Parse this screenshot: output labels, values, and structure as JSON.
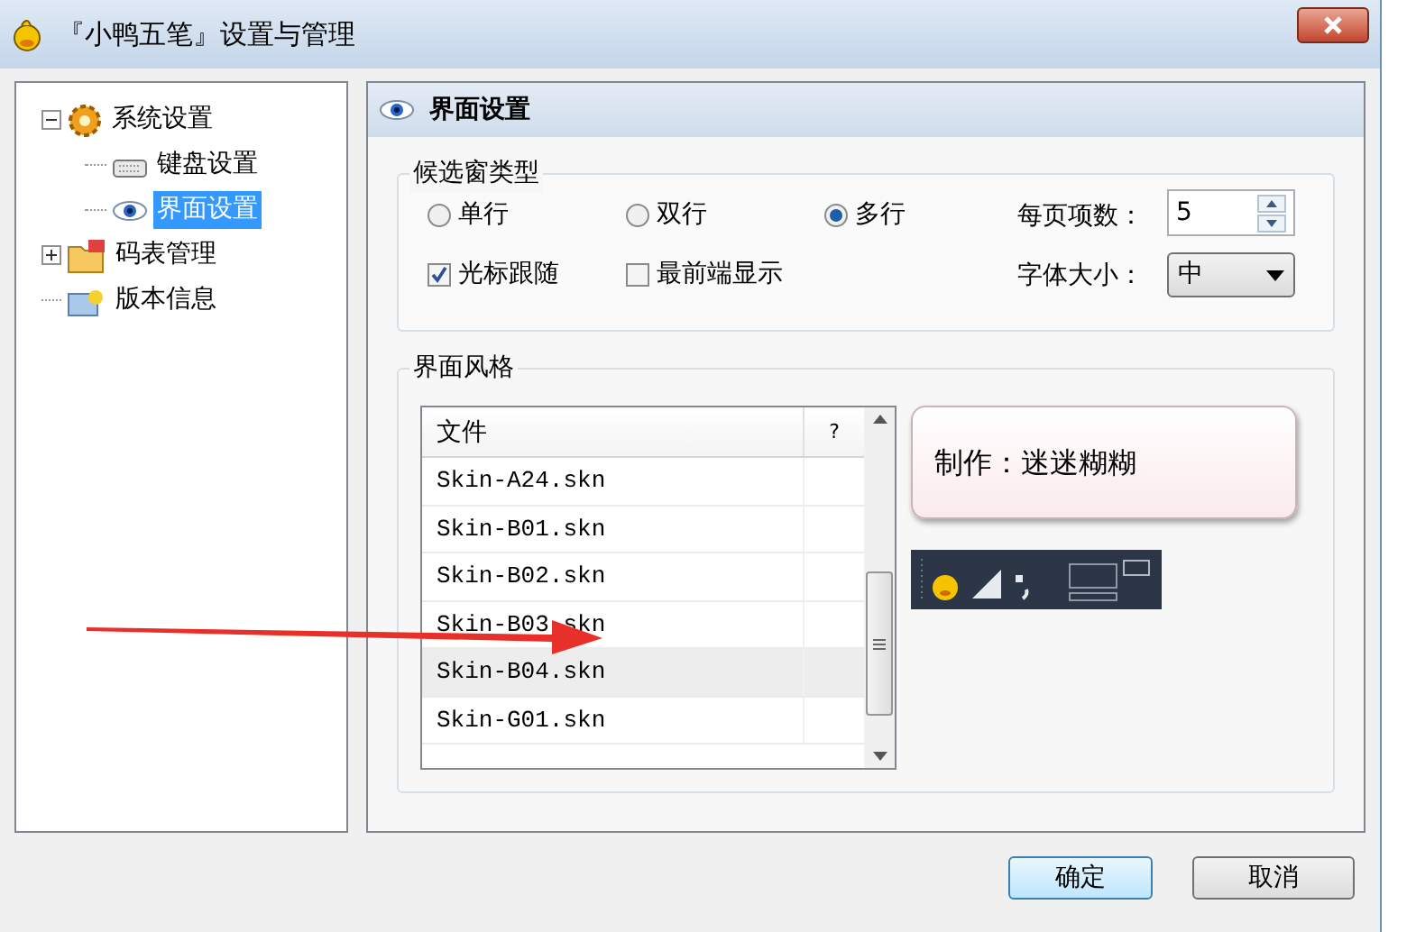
{
  "window": {
    "title": "『小鸭五笔』设置与管理"
  },
  "tree": [
    {
      "label": "系统设置",
      "expanded": true,
      "selected": false,
      "children": [
        {
          "label": "键盘设置",
          "selected": false
        },
        {
          "label": "界面设置",
          "selected": true
        }
      ]
    },
    {
      "label": "码表管理",
      "expanded": false,
      "selected": false
    },
    {
      "label": "版本信息",
      "selected": false
    }
  ],
  "panel": {
    "title": "界面设置"
  },
  "candidate_window": {
    "title": "候选窗类型",
    "layout_options": [
      {
        "label": "单行",
        "selected": false
      },
      {
        "label": "双行",
        "selected": false
      },
      {
        "label": "多行",
        "selected": true
      }
    ],
    "checkboxes": [
      {
        "label": "光标跟随",
        "checked": true
      },
      {
        "label": "最前端显示",
        "checked": false
      }
    ],
    "items_per_page": {
      "label": "每页项数：",
      "value": "5"
    },
    "font_size": {
      "label": "字体大小：",
      "value": "中"
    }
  },
  "style": {
    "title": "界面风格",
    "columns": [
      "文件",
      "?"
    ],
    "rows": [
      {
        "file": "Skin-A24.skn",
        "selected": false
      },
      {
        "file": "Skin-B01.skn",
        "selected": false
      },
      {
        "file": "Skin-B02.skn",
        "selected": false
      },
      {
        "file": "Skin-B03.skn",
        "selected": false
      },
      {
        "file": "Skin-B04.skn",
        "selected": true
      },
      {
        "file": "Skin-G01.skn",
        "selected": false
      }
    ],
    "author": "制作：迷迷糊糊"
  },
  "buttons": [
    "确定",
    "取消"
  ]
}
